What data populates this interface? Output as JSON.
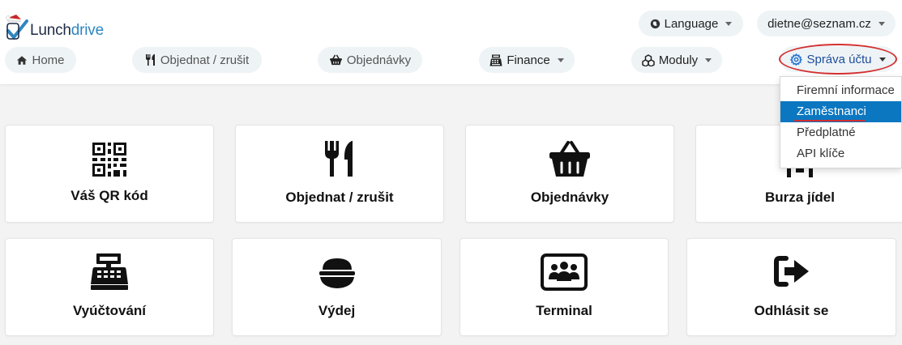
{
  "brand": {
    "name_part1": "Lunch",
    "name_part2": "drive"
  },
  "header": {
    "language_label": "Language",
    "user_email": "dietne@seznam.cz"
  },
  "nav": {
    "home": "Home",
    "order_cancel": "Objednat / zrušit",
    "orders": "Objednávky",
    "finance": "Finance",
    "modules": "Moduly",
    "account": "Správa účtu"
  },
  "account_menu": {
    "items": [
      "Firemní informace",
      "Zaměstnanci",
      "Předplatné",
      "API klíče"
    ],
    "selected": "Zaměstnanci"
  },
  "tiles": [
    {
      "label": "Váš QR kód",
      "icon": "qr-code-icon"
    },
    {
      "label": "Objednat / zrušit",
      "icon": "utensils-icon"
    },
    {
      "label": "Objednávky",
      "icon": "basket-icon"
    },
    {
      "label": "Burza jídel",
      "icon": "food-exchange-icon"
    },
    {
      "label": "Vyúčtování",
      "icon": "cash-register-icon"
    },
    {
      "label": "Výdej",
      "icon": "food-bowl-icon"
    },
    {
      "label": "Terminal",
      "icon": "terminal-users-icon"
    },
    {
      "label": "Odhlásit se",
      "icon": "logout-icon"
    }
  ],
  "colors": {
    "accent": "#0b77c1",
    "highlight": "#d32f2f",
    "logo_blue": "#2e86c1"
  }
}
